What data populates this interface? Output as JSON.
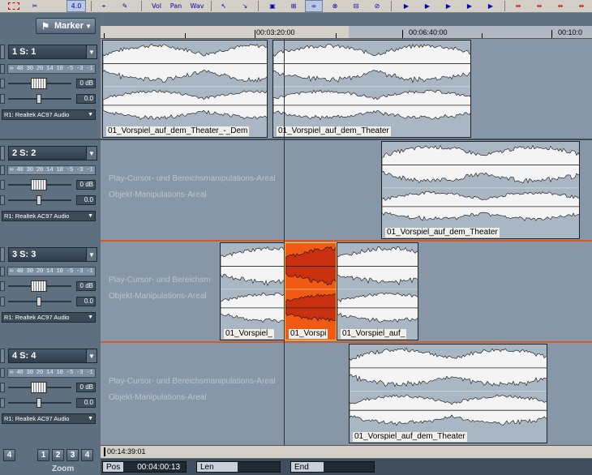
{
  "toolbar": {
    "buttons": [
      {
        "icon": "dashed-rect-icon",
        "label": ""
      },
      {
        "icon": "scissors-icon",
        "label": ""
      },
      {
        "icon": "zoom-icon",
        "label": "4.0"
      },
      {
        "icon": "cursor-icon",
        "label": ""
      },
      {
        "icon": "draw-icon",
        "label": ""
      },
      {
        "icon": "vol-icon",
        "label": "Vol"
      },
      {
        "icon": "pan-icon",
        "label": "Pan"
      },
      {
        "icon": "wav-icon",
        "label": "Wav"
      },
      {
        "icon": "pointer-icon",
        "label": ""
      },
      {
        "icon": "pointer2-icon",
        "label": ""
      },
      {
        "icon": "folder-icon",
        "label": ""
      },
      {
        "icon": "link-icon",
        "label": ""
      },
      {
        "icon": "link2-icon",
        "label": ""
      },
      {
        "icon": "grid-icon",
        "label": ""
      },
      {
        "icon": "chain-icon",
        "label": ""
      },
      {
        "icon": "play-start-icon",
        "label": ""
      },
      {
        "icon": "play-icon",
        "label": ""
      },
      {
        "icon": "play-range-icon",
        "label": ""
      },
      {
        "icon": "play-end-icon",
        "label": ""
      },
      {
        "icon": "play-loop-icon",
        "label": ""
      },
      {
        "icon": "fx-icon",
        "label": ""
      },
      {
        "icon": "fx2-icon",
        "label": ""
      },
      {
        "icon": "fx3-icon",
        "label": ""
      },
      {
        "icon": "fx4-icon",
        "label": ""
      }
    ]
  },
  "marker": {
    "label": "Marker",
    "icon": "marker-icon"
  },
  "ruler": {
    "labels": [
      "00:03:20:00",
      "00:06:40:00",
      "00:10:0"
    ]
  },
  "tracks": [
    {
      "name": "1  S: 1",
      "meter": "∞ 40 30 20 14 10 -5 -3 -1 0",
      "volume": "0 dB",
      "pan": "0.0",
      "output": "R1: Realtek AC97 Audio",
      "lane_text": [
        "",
        ""
      ],
      "clips": [
        "01_Vorspiel_auf_dem_Theater_-_Dem",
        "01_Vorspiel_auf_dem_Theater"
      ]
    },
    {
      "name": "2  S: 2",
      "meter": "∞ 40 30 20 14 10 -5 -3 -1 0",
      "volume": "0 dB",
      "pan": "0.0",
      "output": "R1: Realtek AC97 Audio",
      "lane_text": [
        "Play-Cursor- und Bereichsmanipulations-Areal",
        "Objekt-Manipulations-Areal"
      ],
      "clips": [
        "01_Vorspiel_auf_dem_Theater"
      ]
    },
    {
      "name": "3  S: 3",
      "meter": "∞ 40 30 20 14 10 -5 -3 -1 0",
      "volume": "0 dB",
      "pan": "0.0",
      "output": "R1: Realtek AC97 Audio",
      "lane_text": [
        "Play-Cursor- und Bereichsm",
        "Objekt-Manipulations-Areal"
      ],
      "clips": [
        "01_Vorspiel_",
        "01_Vorspi",
        "01_Vorspiel_auf_"
      ]
    },
    {
      "name": "4  S: 4",
      "meter": "∞ 40 30 20 14 10 -5 -3 -1 0",
      "volume": "0 dB",
      "pan": "0.0",
      "output": "R1: Realtek AC97 Audio",
      "lane_text": [
        "Play-Cursor- und Bereichsmanipulations-Areal",
        "Objekt-Manipulations-Areal"
      ],
      "clips": [
        "01_Vorspiel_auf_dem_Theater"
      ]
    }
  ],
  "timecode": "00:14:39:01",
  "zoom": {
    "label": "Zoom",
    "buttons": [
      "4",
      "1",
      "2",
      "3",
      "4"
    ]
  },
  "status": {
    "pos_label": "Pos",
    "pos_value": "00:04:00:13",
    "len_label": "Len",
    "len_value": "",
    "end_label": "End",
    "end_value": ""
  },
  "colors": {
    "accent": "#d05a28",
    "selection": "#f05a14"
  }
}
